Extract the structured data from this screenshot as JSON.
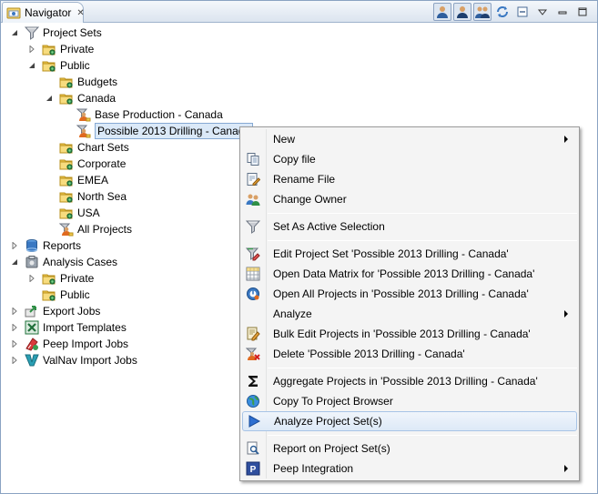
{
  "tab": {
    "title": "Navigator"
  },
  "tree": [
    {
      "id": "project-sets",
      "label": "Project Sets",
      "icon": "funnel-icon",
      "expanded": true
    },
    {
      "id": "private",
      "label": "Private",
      "icon": "folder-icon",
      "expanded": false
    },
    {
      "id": "public",
      "label": "Public",
      "icon": "folder-icon",
      "expanded": true
    },
    {
      "id": "budgets",
      "label": "Budgets",
      "icon": "folder-icon"
    },
    {
      "id": "canada",
      "label": "Canada",
      "icon": "folder-icon",
      "expanded": true
    },
    {
      "id": "base-production-canada",
      "label": "Base Production - Canada",
      "icon": "project-set-icon"
    },
    {
      "id": "possible-2013-drilling-canada",
      "label": "Possible 2013 Drilling - Canada",
      "icon": "project-set-icon",
      "selected": true
    },
    {
      "id": "chart-sets",
      "label": "Chart Sets",
      "icon": "folder-icon"
    },
    {
      "id": "corporate",
      "label": "Corporate",
      "icon": "folder-icon"
    },
    {
      "id": "emea",
      "label": "EMEA",
      "icon": "folder-icon"
    },
    {
      "id": "north-sea",
      "label": "North Sea",
      "icon": "folder-icon"
    },
    {
      "id": "usa",
      "label": "USA",
      "icon": "folder-icon"
    },
    {
      "id": "all-projects",
      "label": "All Projects",
      "icon": "project-set-icon"
    },
    {
      "id": "reports",
      "label": "Reports",
      "icon": "reports-icon",
      "expanded": false
    },
    {
      "id": "analysis-cases",
      "label": "Analysis Cases",
      "icon": "analysis-cases-icon",
      "expanded": true
    },
    {
      "id": "ac-private",
      "label": "Private",
      "icon": "folder-icon",
      "expanded": false
    },
    {
      "id": "ac-public",
      "label": "Public",
      "icon": "folder-icon"
    },
    {
      "id": "export-jobs",
      "label": "Export Jobs",
      "icon": "export-icon",
      "expanded": false
    },
    {
      "id": "import-templates",
      "label": "Import Templates",
      "icon": "excel-icon",
      "expanded": false
    },
    {
      "id": "peep-import-jobs",
      "label": "Peep Import Jobs",
      "icon": "peep-import-icon",
      "expanded": false
    },
    {
      "id": "valnav-import-jobs",
      "label": "ValNav Import Jobs",
      "icon": "valnav-icon",
      "expanded": false
    }
  ],
  "menu": {
    "items": [
      {
        "label": "New",
        "icon": "",
        "submenu": true
      },
      {
        "label": "Copy file",
        "icon": "copy-icon"
      },
      {
        "label": "Rename File",
        "icon": "rename-icon"
      },
      {
        "label": "Change Owner",
        "icon": "users-icon"
      },
      {
        "label": "Set As Active Selection",
        "icon": "funnel-icon"
      },
      {
        "label": "Edit Project Set 'Possible 2013 Drilling - Canada'",
        "icon": "edit-funnel-icon"
      },
      {
        "label": "Open Data Matrix for 'Possible 2013 Drilling - Canada'",
        "icon": "grid-icon"
      },
      {
        "label": "Open All Projects in 'Possible 2013 Drilling - Canada'",
        "icon": "open-projects-icon"
      },
      {
        "label": "Analyze",
        "icon": "",
        "submenu": true
      },
      {
        "label": "Bulk Edit Projects in 'Possible 2013 Drilling - Canada'",
        "icon": "bulk-edit-icon"
      },
      {
        "label": "Delete 'Possible 2013 Drilling - Canada'",
        "icon": "delete-icon"
      },
      {
        "label": "Aggregate Projects in 'Possible 2013 Drilling - Canada'",
        "icon": "sigma-icon"
      },
      {
        "label": "Copy To Project Browser",
        "icon": "globe-icon"
      },
      {
        "label": "Analyze Project Set(s)",
        "icon": "play-icon",
        "hover": true
      },
      {
        "label": "Report on Project Set(s)",
        "icon": "report-search-icon"
      },
      {
        "label": "Peep Integration",
        "icon": "peep-icon",
        "submenu": true
      }
    ]
  },
  "colors": {
    "accent": "#3a78c2",
    "folder": "#f2c94c",
    "selection": "#dbe9f8"
  }
}
